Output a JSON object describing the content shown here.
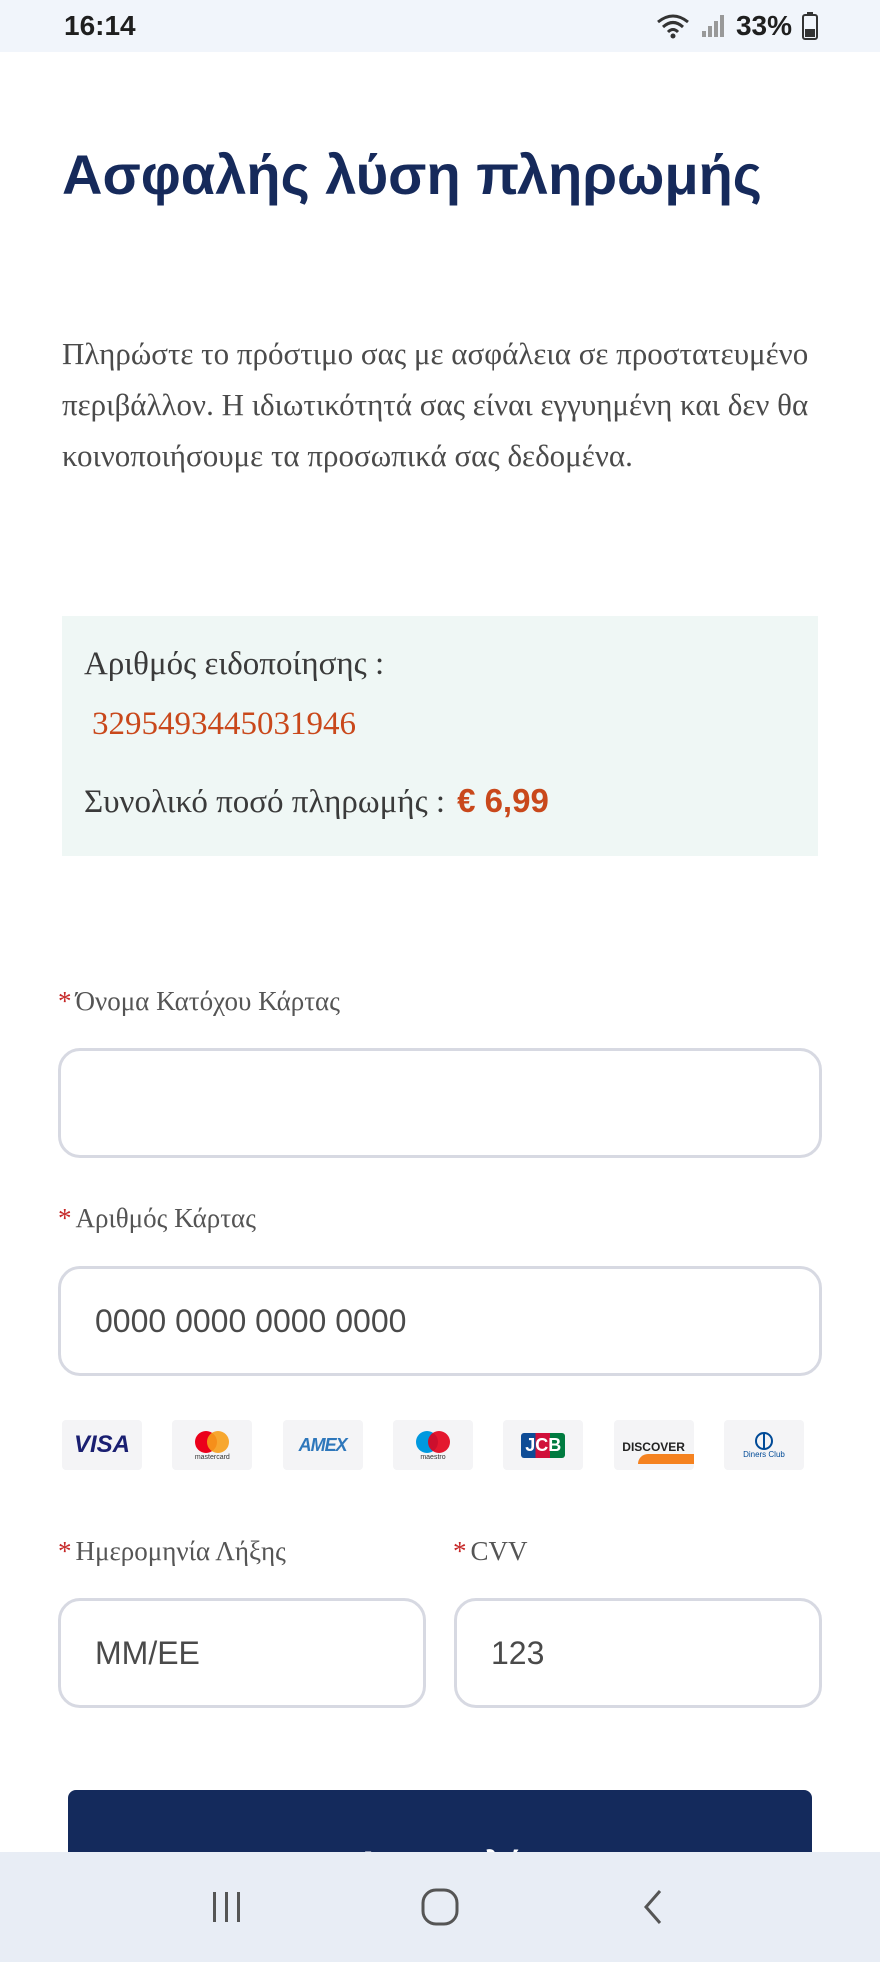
{
  "status_bar": {
    "time": "16:14",
    "battery": "33%",
    "icons": [
      "wifi-icon",
      "signal-icon",
      "battery-icon"
    ]
  },
  "page": {
    "title": "Ασφαλής λύση πληρωμής",
    "intro": "Πληρώστε το πρόστιμο σας με ασφάλεια σε προστατευμένο περιβάλλον. Η ιδιωτικότητά σας είναι εγγυημένη και δεν θα κοινοποιήσουμε τα προσωπικά σας δεδομένα."
  },
  "summary": {
    "notice_label": "Αριθμός ειδοποίησης :",
    "notice_number": "3295493445031946",
    "total_label": "Συνολικό ποσό πληρωμής :",
    "total_amount": "€ 6,99"
  },
  "form": {
    "required_mark": "*",
    "holder_label": "Όνομα Κατόχου Κάρτας",
    "holder_value": "",
    "card_label": "Αριθμός Κάρτας",
    "card_placeholder": "0000 0000 0000 0000",
    "expiry_label": "Ημερομηνία Λήξης",
    "expiry_placeholder": "MM/EE",
    "cvv_label": "CVV",
    "cvv_placeholder": "123",
    "submit_label": "Αποστολή"
  },
  "card_brands": {
    "visa": "VISA",
    "mastercard": "mastercard",
    "amex": "AMEX",
    "maestro": "maestro",
    "jcb": "JCB",
    "discover": "DISCOVER",
    "diners": "Diners Club"
  },
  "colors": {
    "title": "#162a5b",
    "accent": "#c9481b",
    "button": "#142a5c",
    "summary_bg": "#eff7f5",
    "required": "#c62828"
  }
}
